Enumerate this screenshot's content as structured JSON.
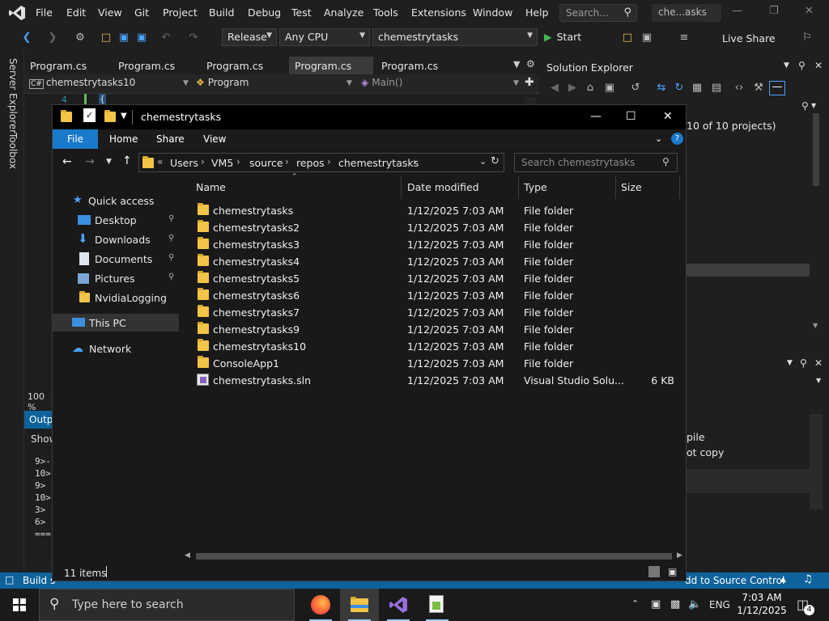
{
  "vs": {
    "menu": [
      "File",
      "Edit",
      "View",
      "Git",
      "Project",
      "Build",
      "Debug",
      "Test",
      "Analyze",
      "Tools",
      "Extensions",
      "Window",
      "Help"
    ],
    "search_placeholder": "Search...",
    "window_title": "che...asks",
    "toolbar": {
      "configuration": "Release",
      "platform": "Any CPU",
      "startup_project": "chemestrytasks",
      "start_label": "Start",
      "live_share": "Live Share"
    },
    "side_tabs": [
      "Server Explorer",
      "Toolbox"
    ],
    "doc_tabs": [
      "Program.cs",
      "Program.cs",
      "Program.cs",
      "Program.cs",
      "Program.cs"
    ],
    "active_doc_tab": 3,
    "nav": {
      "project": "chemestrytasks10",
      "class": "Program",
      "member": "Main()"
    },
    "code": {
      "line_number": "4",
      "brace": "{"
    },
    "zoom": "100 %",
    "output": {
      "title": "Outp",
      "show_label": "Show",
      "lines": [
        "9>-",
        "10>",
        "9>",
        "10>",
        "3>",
        "6>",
        "==="
      ]
    },
    "solution_explorer": {
      "title": "Solution Explorer",
      "tree_text": "10 of 10 projects)"
    },
    "properties": {
      "rows": [
        "pile",
        "ot copy"
      ]
    },
    "status": {
      "left": "Build s",
      "right": "dd to Source Control"
    }
  },
  "explorer": {
    "title": "chemestrytasks",
    "ribbon_tabs": [
      "File",
      "Home",
      "Share",
      "View"
    ],
    "breadcrumb": [
      "Users",
      "VM5",
      "source",
      "repos",
      "chemestrytasks"
    ],
    "search_placeholder": "Search chemestrytasks",
    "nav_pane": [
      {
        "label": "Quick access",
        "icon": "star-icon",
        "pinned": false
      },
      {
        "label": "Desktop",
        "icon": "desktop-icon",
        "pinned": true
      },
      {
        "label": "Downloads",
        "icon": "download-icon",
        "pinned": true
      },
      {
        "label": "Documents",
        "icon": "documents-icon",
        "pinned": true
      },
      {
        "label": "Pictures",
        "icon": "pictures-icon",
        "pinned": true
      },
      {
        "label": "NvidiaLogging",
        "icon": "folder-icon",
        "pinned": false
      },
      {
        "label": "This PC",
        "icon": "computer-icon",
        "pinned": false
      },
      {
        "label": "Network",
        "icon": "network-icon",
        "pinned": false
      }
    ],
    "columns": [
      "Name",
      "Date modified",
      "Type",
      "Size"
    ],
    "files": [
      {
        "name": "chemestrytasks",
        "date": "1/12/2025 7:03 AM",
        "type": "File folder",
        "size": "",
        "icon": "folder-icon"
      },
      {
        "name": "chemestrytasks2",
        "date": "1/12/2025 7:03 AM",
        "type": "File folder",
        "size": "",
        "icon": "folder-icon"
      },
      {
        "name": "chemestrytasks3",
        "date": "1/12/2025 7:03 AM",
        "type": "File folder",
        "size": "",
        "icon": "folder-icon"
      },
      {
        "name": "chemestrytasks4",
        "date": "1/12/2025 7:03 AM",
        "type": "File folder",
        "size": "",
        "icon": "folder-icon"
      },
      {
        "name": "chemestrytasks5",
        "date": "1/12/2025 7:03 AM",
        "type": "File folder",
        "size": "",
        "icon": "folder-icon"
      },
      {
        "name": "chemestrytasks6",
        "date": "1/12/2025 7:03 AM",
        "type": "File folder",
        "size": "",
        "icon": "folder-icon"
      },
      {
        "name": "chemestrytasks7",
        "date": "1/12/2025 7:03 AM",
        "type": "File folder",
        "size": "",
        "icon": "folder-icon"
      },
      {
        "name": "chemestrytasks9",
        "date": "1/12/2025 7:03 AM",
        "type": "File folder",
        "size": "",
        "icon": "folder-icon"
      },
      {
        "name": "chemestrytasks10",
        "date": "1/12/2025 7:03 AM",
        "type": "File folder",
        "size": "",
        "icon": "folder-icon"
      },
      {
        "name": "ConsoleApp1",
        "date": "1/12/2025 7:03 AM",
        "type": "File folder",
        "size": "",
        "icon": "folder-icon"
      },
      {
        "name": "chemestrytasks.sln",
        "date": "1/12/2025 7:03 AM",
        "type": "Visual Studio Solu...",
        "size": "6 KB",
        "icon": "solution-file-icon"
      }
    ],
    "status": "11 items"
  },
  "taskbar": {
    "search_placeholder": "Type here to search",
    "apps": [
      "firefox-icon",
      "file-explorer-icon",
      "visual-studio-icon",
      "notepad-plus-icon"
    ],
    "tray": {
      "language": "ENG",
      "notification_count": "4"
    },
    "clock": {
      "time": "7:03 AM",
      "date": "1/12/2025"
    }
  },
  "colors": {
    "vs_accent": "#0e639c",
    "explorer_file_tab": "#1979ca",
    "folder": "#f2c447",
    "start_green": "#3fb950"
  }
}
